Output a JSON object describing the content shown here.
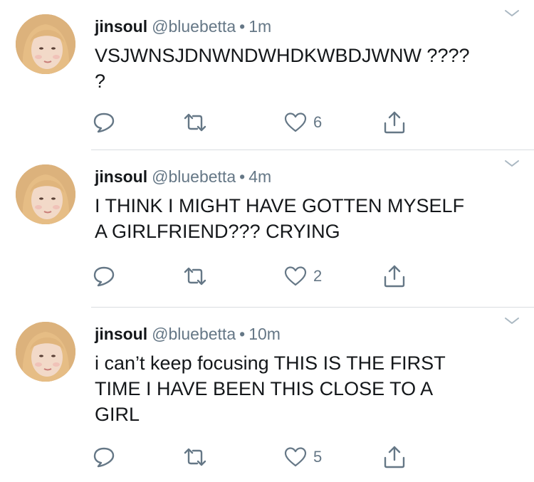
{
  "tweets": [
    {
      "name": "jinsoul",
      "handle": "@bluebetta",
      "separator": "•",
      "time": "1m",
      "text": "VSJWNSJDNWNDWHDKWBDJWNW ????\n?",
      "likes": "6"
    },
    {
      "name": "jinsoul",
      "handle": "@bluebetta",
      "separator": "•",
      "time": "4m",
      "text": "I THINK I MIGHT HAVE GOTTEN MYSELF\nA GIRLFRIEND??? CRYING",
      "likes": "2"
    },
    {
      "name": "jinsoul",
      "handle": "@bluebetta",
      "separator": "•",
      "time": "10m",
      "text": "i can’t keep focusing THIS IS THE FIRST\nTIME I HAVE BEEN THIS CLOSE TO A\nGIRL",
      "likes": "5"
    }
  ],
  "icons": {
    "reply": "reply-icon",
    "retweet": "retweet-icon",
    "like": "heart-icon",
    "share": "share-icon",
    "menu": "chevron-down-icon"
  },
  "colors": {
    "text": "#14171a",
    "secondary": "#657786",
    "divider": "#d9dde1"
  }
}
